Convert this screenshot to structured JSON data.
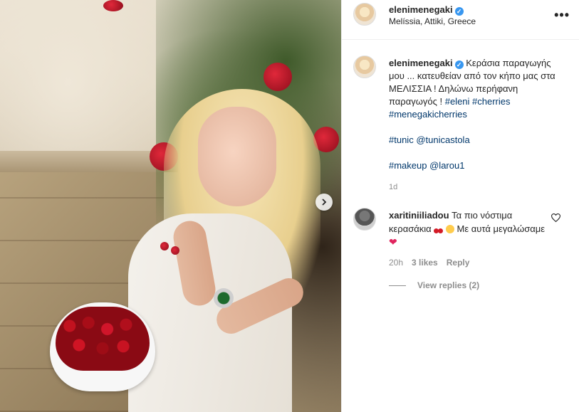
{
  "post": {
    "username": "elenimenegaki",
    "location": "Melíssia, Attiki, Greece"
  },
  "caption": {
    "username": "elenimenegaki",
    "text": "Κεράσια παραγωγής μου ... κατευθείαν από τον κήπο μας στα ΜΕΛΙΣΣΙΑ ! Δηλώνω περήφανη παραγωγός !",
    "hashtags": "#eleni #cherries #menegakicherries",
    "tunic_label": "#tunic",
    "tunic_mention": "@tunicastola",
    "makeup_label": "#makeup",
    "makeup_mention": "@larou1",
    "time": "1d"
  },
  "comment": {
    "username": "xaritiniiliadou",
    "text_part1": "Τα πιο νόστιμα κερασάκια",
    "text_part2": "Με αυτά μεγαλώσαμε",
    "time": "20h",
    "likes": "3 likes",
    "reply_label": "Reply",
    "view_replies": "View replies (2)"
  },
  "icons": {
    "verified": "verified-badge-icon",
    "more": "more-options-icon",
    "next": "chevron-right-icon",
    "like": "heart-outline-icon"
  },
  "colors": {
    "verified": "#3897f0",
    "link": "#00376b",
    "muted": "#8e8e8e"
  }
}
